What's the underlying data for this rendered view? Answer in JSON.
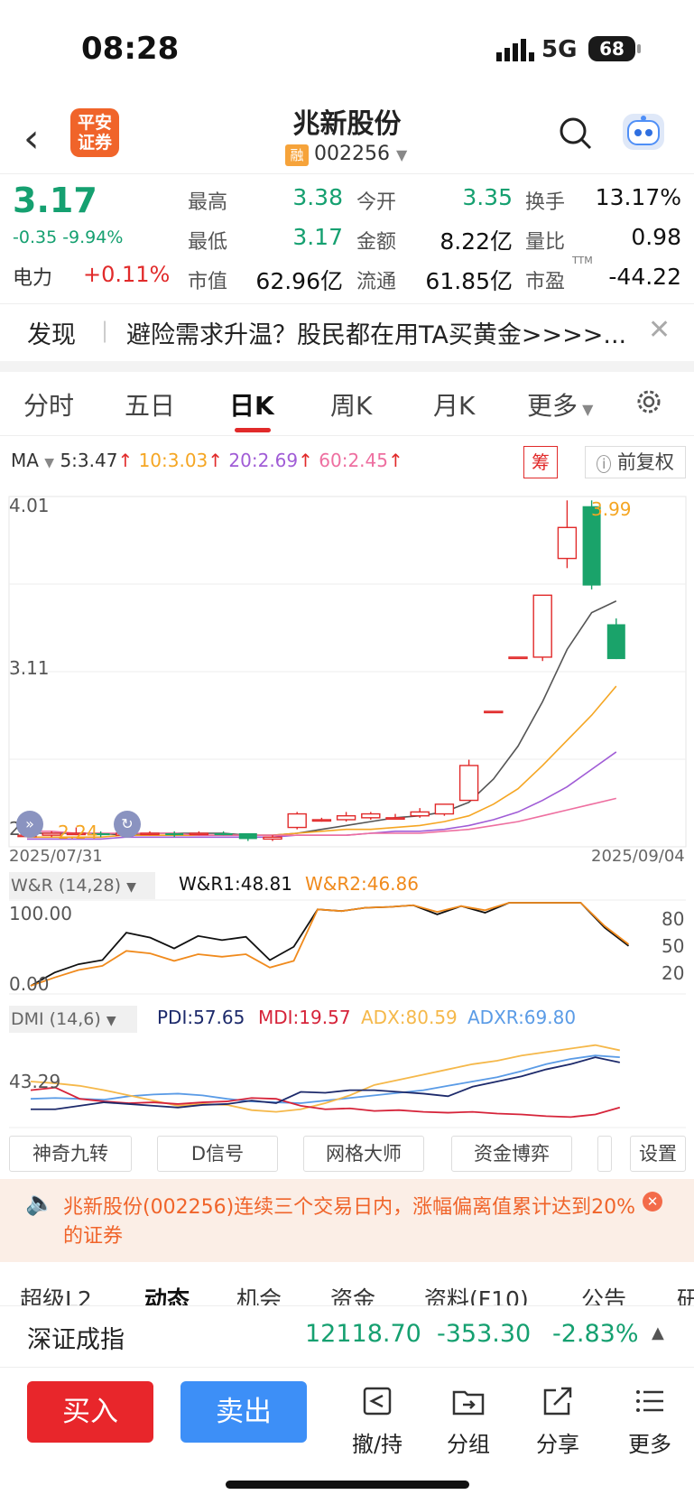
{
  "status": {
    "time": "08:28",
    "network": "5G",
    "battery": "68"
  },
  "nav": {
    "title": "兆新股份",
    "rong": "融",
    "code": "002256",
    "logo_line1": "平安",
    "logo_line2": "证券"
  },
  "quote": {
    "price": "3.17",
    "change": "-0.35 -9.94%",
    "dianli_label": "电力",
    "dianli_value": "+0.11%",
    "rows": [
      [
        {
          "l": "最高",
          "v": "3.38"
        },
        {
          "l": "今开",
          "v": "3.35"
        },
        {
          "l": "换手",
          "v": "13.17%"
        }
      ],
      [
        {
          "l": "最低",
          "v": "3.17"
        },
        {
          "l": "金额",
          "v": "8.22亿"
        },
        {
          "l": "量比",
          "v": "0.98"
        }
      ],
      [
        {
          "l": "市值",
          "v": "62.96亿"
        },
        {
          "l": "流通",
          "v": "61.85亿"
        },
        {
          "l": "市盈",
          "v": "-44.22",
          "sup": "TTM"
        }
      ]
    ]
  },
  "banner": {
    "label": "发现",
    "text": "避险需求升温？股民都在用TA买黄金>>>>..."
  },
  "tabs": [
    "分时",
    "五日",
    "日K",
    "周K",
    "月K",
    "更多"
  ],
  "ma": {
    "label": "MA",
    "ma5": "5:3.47",
    "ma10": "10:3.03",
    "ma20": "20:2.69",
    "ma60": "60:2.45",
    "chou": "筹",
    "fuquan": "前复权"
  },
  "chart_data": {
    "type": "candlestick",
    "y_ticks": [
      "4.01",
      "3.11",
      "2.2"
    ],
    "ylim": [
      2.2,
      4.01
    ],
    "high_label": "3.99",
    "low_label": "2.24",
    "date_start": "2025/07/31",
    "date_end": "2025/09/04",
    "candles": [
      [
        2.26,
        2.27,
        2.25,
        2.26
      ],
      [
        2.26,
        2.28,
        2.25,
        2.27
      ],
      [
        2.27,
        2.3,
        2.26,
        2.27
      ],
      [
        2.27,
        2.28,
        2.25,
        2.26
      ],
      [
        2.26,
        2.28,
        2.25,
        2.27
      ],
      [
        2.27,
        2.28,
        2.26,
        2.27
      ],
      [
        2.27,
        2.28,
        2.25,
        2.26
      ],
      [
        2.27,
        2.28,
        2.26,
        2.27
      ],
      [
        2.27,
        2.28,
        2.26,
        2.26
      ],
      [
        2.27,
        2.27,
        2.23,
        2.24
      ],
      [
        2.24,
        2.26,
        2.23,
        2.25
      ],
      [
        2.3,
        2.38,
        2.29,
        2.37
      ],
      [
        2.34,
        2.35,
        2.33,
        2.34
      ],
      [
        2.34,
        2.38,
        2.33,
        2.36
      ],
      [
        2.35,
        2.38,
        2.34,
        2.37
      ],
      [
        2.35,
        2.37,
        2.34,
        2.35
      ],
      [
        2.36,
        2.4,
        2.35,
        2.38
      ],
      [
        2.37,
        2.42,
        2.36,
        2.42
      ],
      [
        2.44,
        2.65,
        2.44,
        2.62
      ],
      [
        2.9,
        2.9,
        2.9,
        2.9
      ],
      [
        3.18,
        3.18,
        3.18,
        3.18
      ],
      [
        3.18,
        3.5,
        3.16,
        3.5
      ],
      [
        3.69,
        3.99,
        3.64,
        3.85
      ],
      [
        3.96,
        3.99,
        3.53,
        3.55
      ],
      [
        3.35,
        3.38,
        3.17,
        3.17
      ]
    ],
    "ma_series": [
      {
        "name": "MA5",
        "values": [
          2.27,
          2.27,
          2.27,
          2.27,
          2.26,
          2.27,
          2.27,
          2.27,
          2.27,
          2.26,
          2.26,
          2.27,
          2.29,
          2.31,
          2.33,
          2.35,
          2.36,
          2.38,
          2.43,
          2.55,
          2.72,
          2.95,
          3.22,
          3.41,
          3.47
        ]
      },
      {
        "name": "MA10",
        "values": [
          2.25,
          2.25,
          2.25,
          2.25,
          2.26,
          2.26,
          2.26,
          2.26,
          2.26,
          2.26,
          2.26,
          2.27,
          2.28,
          2.29,
          2.29,
          2.3,
          2.31,
          2.33,
          2.36,
          2.42,
          2.5,
          2.62,
          2.75,
          2.88,
          3.03
        ]
      },
      {
        "name": "MA20",
        "values": [
          2.24,
          2.24,
          2.24,
          2.24,
          2.25,
          2.25,
          2.25,
          2.25,
          2.25,
          2.25,
          2.25,
          2.26,
          2.26,
          2.26,
          2.27,
          2.28,
          2.28,
          2.29,
          2.31,
          2.34,
          2.38,
          2.44,
          2.51,
          2.6,
          2.69
        ]
      },
      {
        "name": "MA60",
        "values": [
          2.28,
          2.28,
          2.27,
          2.27,
          2.27,
          2.27,
          2.27,
          2.26,
          2.26,
          2.26,
          2.26,
          2.26,
          2.26,
          2.26,
          2.27,
          2.27,
          2.27,
          2.28,
          2.29,
          2.31,
          2.33,
          2.36,
          2.39,
          2.42,
          2.45
        ]
      }
    ],
    "wr": {
      "label": "W&R (14,28)",
      "wr1_label": "W&R1:48.81",
      "wr2_label": "W&R2:46.86",
      "left_ticks": [
        "100.00",
        "0.00"
      ],
      "right_ticks": [
        "80",
        "50",
        "20"
      ],
      "wr1": [
        100,
        84,
        74,
        69,
        36,
        42,
        55,
        40,
        45,
        41,
        69,
        53,
        8,
        10,
        6,
        5,
        3,
        14,
        4,
        12,
        0,
        0,
        0,
        0,
        30,
        52
      ],
      "wr2": [
        100,
        90,
        81,
        76,
        58,
        61,
        70,
        62,
        65,
        62,
        78,
        70,
        8,
        10,
        6,
        5,
        3,
        11,
        4,
        9,
        0,
        0,
        0,
        0,
        28,
        50
      ]
    },
    "dmi": {
      "label": "DMI (14,6)",
      "pdi_label": "PDI:57.65",
      "mdi_label": "MDI:19.57",
      "adx_label": "ADX:80.59",
      "adxr_label": "ADXR:69.80",
      "tick": "43.29",
      "pdi": [
        18,
        18,
        22,
        26,
        24,
        22,
        20,
        23,
        24,
        28,
        25,
        38,
        37,
        40,
        40,
        38,
        36,
        33,
        44,
        50,
        56,
        64,
        70,
        78,
        72
      ],
      "mdi": [
        40,
        43,
        30,
        27,
        25,
        26,
        24,
        26,
        27,
        31,
        30,
        22,
        18,
        19,
        16,
        17,
        15,
        14,
        15,
        13,
        12,
        10,
        9,
        12,
        20
      ],
      "adx": [
        50,
        48,
        45,
        40,
        34,
        28,
        22,
        24,
        23,
        17,
        15,
        18,
        25,
        34,
        46,
        52,
        58,
        64,
        70,
        74,
        80,
        84,
        88,
        92,
        86
      ],
      "adxr": [
        30,
        31,
        30,
        29,
        33,
        35,
        36,
        34,
        30,
        27,
        26,
        25,
        28,
        31,
        34,
        37,
        40,
        45,
        50,
        55,
        62,
        70,
        76,
        80,
        78
      ]
    }
  },
  "tools": [
    "神奇九转",
    "D信号",
    "网格大师",
    "资金博弈",
    "设置"
  ],
  "notice": {
    "text": "兆新股份(002256)连续三个交易日内，涨幅偏离值累计达到20%的证券"
  },
  "bottom_tabs": [
    "超级L2",
    "动态",
    "机会",
    "资金",
    "资料(F10)",
    "公告",
    "研"
  ],
  "index": {
    "name": "深证成指",
    "value": "12118.70",
    "change": "-353.30",
    "pct": "-2.83%"
  },
  "actions": {
    "buy": "买入",
    "sell": "卖出",
    "chehang": "撤/持",
    "group": "分组",
    "share": "分享",
    "more": "更多"
  }
}
